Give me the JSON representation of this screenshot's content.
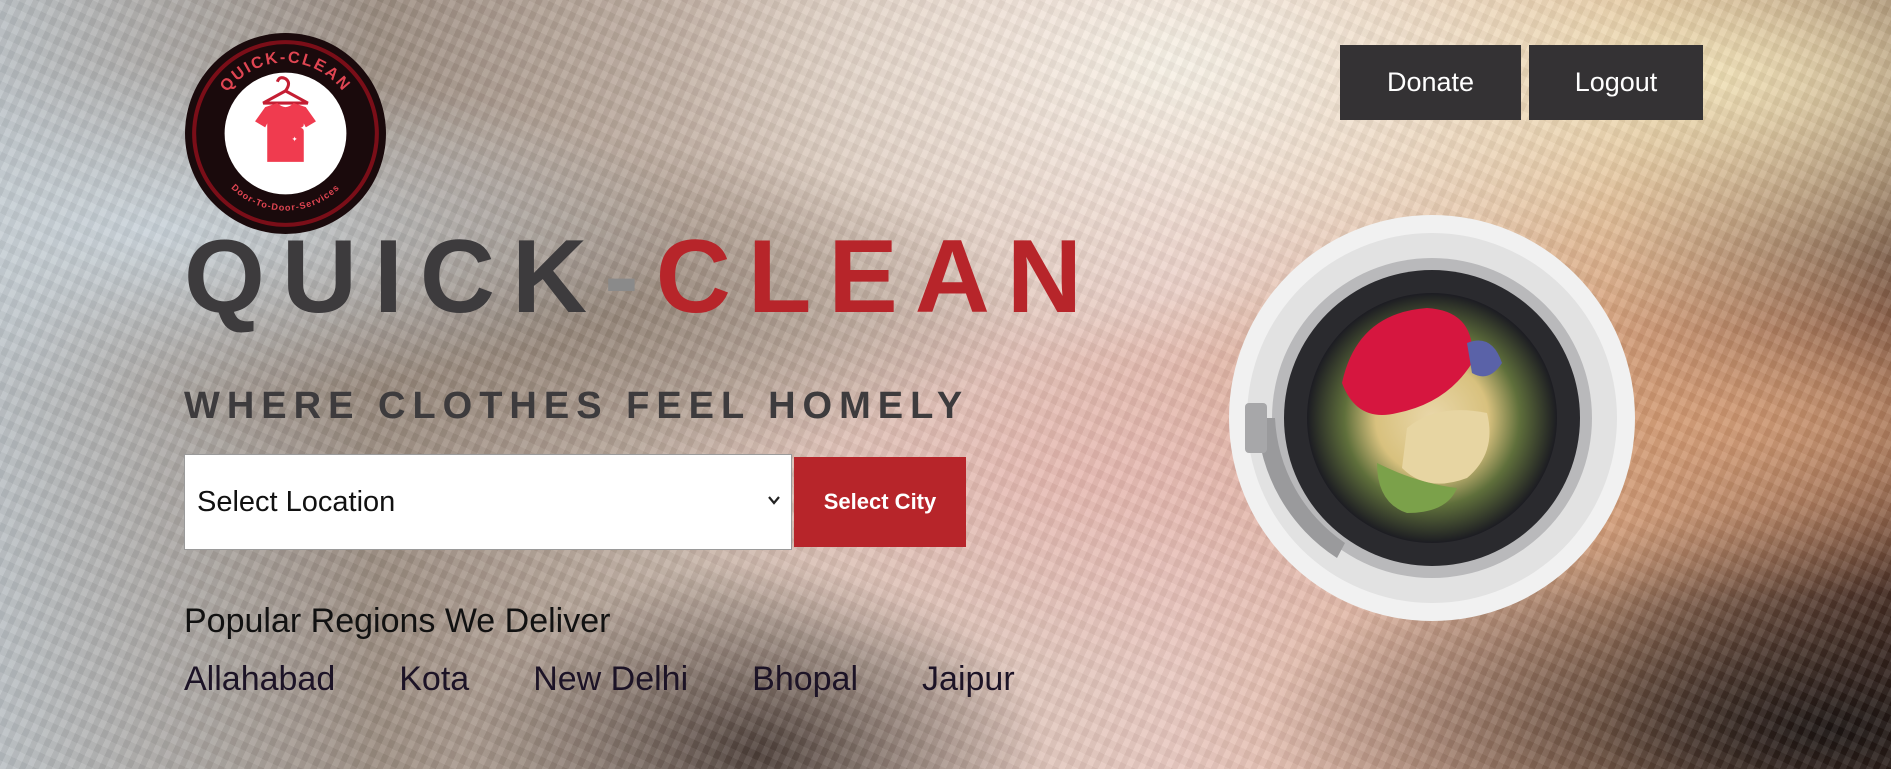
{
  "logo": {
    "ring_text_top": "QUICK-CLEAN",
    "ring_text_bottom": "Door-To-Door-Services",
    "icon": "tshirt-hanger-icon"
  },
  "nav": {
    "donate_label": "Donate",
    "logout_label": "Logout"
  },
  "brand": {
    "part1": "QUICK",
    "dash": "-",
    "part2": "CLEAN"
  },
  "tagline": "WHERE CLOTHES FEEL HOMELY",
  "location": {
    "selected": "Select Location",
    "button_label": "Select City"
  },
  "regions": {
    "title": "Popular Regions We Deliver",
    "items": [
      {
        "label": "Allahabad"
      },
      {
        "label": "Kota"
      },
      {
        "label": "New Delhi"
      },
      {
        "label": "Bhopal"
      },
      {
        "label": "Jaipur"
      }
    ]
  },
  "colors": {
    "accent_red": "#b7252a",
    "dark_button": "#343234",
    "heading_dark": "#3d3b3d"
  },
  "icons": [
    "chevron-down-icon",
    "washing-machine-icon"
  ]
}
